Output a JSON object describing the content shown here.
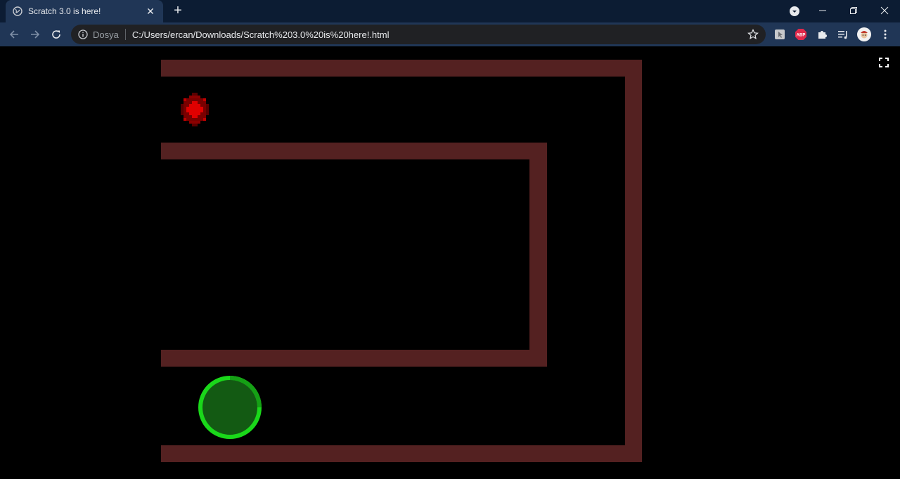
{
  "tab": {
    "title": "Scratch 3.0 is here!",
    "favicon": "globe-icon",
    "close_icon": "close-icon"
  },
  "new_tab_icon": "plus-icon",
  "window_controls": [
    "minimize-icon",
    "restore-icon",
    "close-icon"
  ],
  "toolbar": {
    "back_icon": "arrow-left-icon",
    "forward_icon": "arrow-right-icon",
    "reload_icon": "reload-icon",
    "scheme_label": "Dosya",
    "url": "C:/Users/ercan/Downloads/Scratch%203.0%20is%20here!.html",
    "bookmark_icon": "star-icon",
    "extensions": [
      "mouse-extension-icon",
      "adblock-extension-icon",
      "puzzle-extensions-icon",
      "media-queue-icon",
      "profile-avatar-icon",
      "more-menu-icon"
    ],
    "adblock_label": "ABP"
  },
  "game": {
    "wall_color": "#542121",
    "background_color": "#000000",
    "player_color": "#1ad81a",
    "player_fill": "#135a13",
    "target_color": "#cc0000",
    "fullscreen_icon": "fullscreen-icon"
  }
}
